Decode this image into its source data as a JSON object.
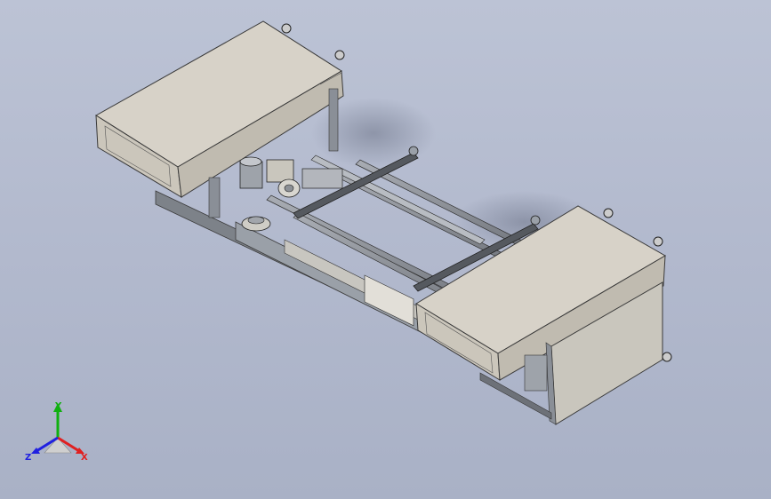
{
  "viewport": {
    "background_top": "#bcc3d5",
    "background_bottom": "#a9b1c6"
  },
  "model": {
    "body_color": "#d7d2c8",
    "frame_color": "#8a8f97",
    "edge_color": "#3a3a3a"
  },
  "triad": {
    "x_label": "X",
    "y_label": "Y",
    "z_label": "Z",
    "x_color": "#e02020",
    "y_color": "#10b010",
    "z_color": "#2020e0"
  }
}
